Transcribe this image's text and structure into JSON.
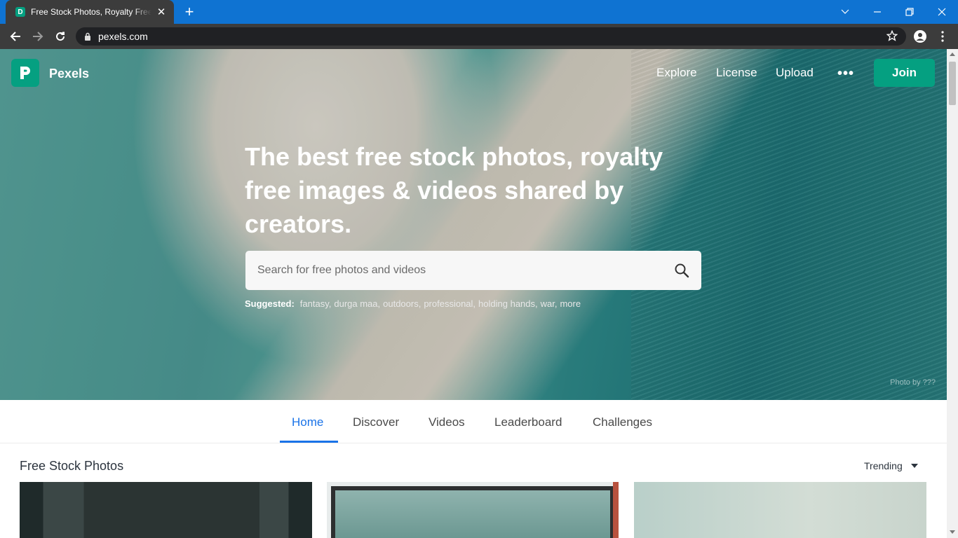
{
  "browser": {
    "tab_title": "Free Stock Photos, Royalty Free Stock Images",
    "tab_favicon_letter": "D",
    "url": "pexels.com",
    "new_tab_label": "+"
  },
  "site": {
    "brand": "Pexels",
    "nav": {
      "explore": "Explore",
      "license": "License",
      "upload": "Upload",
      "more": "•••",
      "join": "Join"
    },
    "hero": {
      "headline": "The best free stock photos, royalty free images & videos shared by creators.",
      "search_placeholder": "Search for free photos and videos",
      "suggested_label": "Suggested:",
      "suggestions": [
        "fantasy,",
        "durga maa,",
        "outdoors,",
        "professional,",
        "holding hands,",
        "war,",
        "more"
      ],
      "photo_credit": "Photo by ???"
    },
    "tabs": {
      "home": "Home",
      "discover": "Discover",
      "videos": "Videos",
      "leaderboard": "Leaderboard",
      "challenges": "Challenges"
    },
    "section_title": "Free Stock Photos",
    "sort_label": "Trending"
  },
  "colors": {
    "titlebar": "#0f73d2",
    "brand_green": "#05a081",
    "active_tab_blue": "#1a73e8"
  }
}
